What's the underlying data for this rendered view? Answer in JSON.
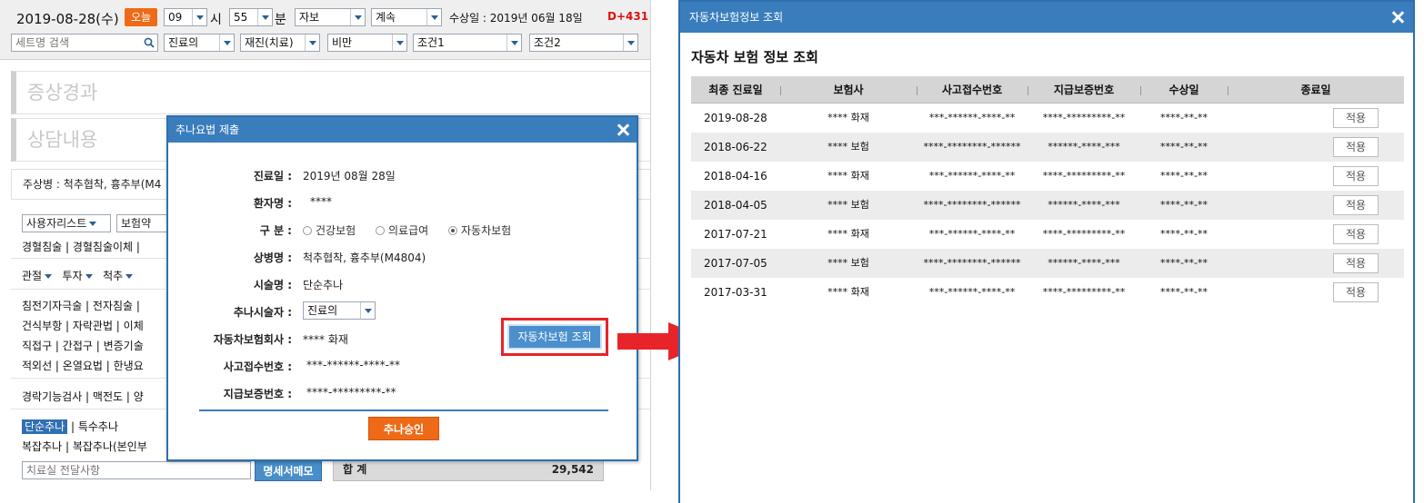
{
  "left_app": {
    "date": "2019-08-28(수)",
    "today_label": "오늘",
    "hour": "09",
    "hour_unit": "시",
    "minute": "55",
    "minute_unit": "분",
    "insurance_type": "자보",
    "continuation": "계속",
    "injury_date": "수상일 : 2019년 06월 18일",
    "d_plus": "D+431",
    "set_search_placeholder": "세트명 검색",
    "therapist_select": "진료의",
    "revisit_select": "재진(치료)",
    "obesity_select": "비만",
    "cond1": "조건1",
    "cond2": "조건2",
    "section_symptom": "증상경과",
    "section_consult": "상담내용",
    "diagnosis": "주상병 : 척추협착, 흉추부(M4",
    "user_list": "사용자리스트",
    "herbal": "보험약",
    "row_acupuncture": "경혈침술  |  경혈침술이체  |",
    "row_joint": [
      "관절",
      "투자",
      "척추"
    ],
    "row_elec1": "침전기자극술  |  전자침술  |",
    "row_elec2": "건식부항  |  자락관법  |  이체",
    "row_elec3": "직접구  |  간접구  |  변증기술",
    "row_elec4": "적외선  |  온열요법  |  한냉요",
    "row_pulse": "경락기능검사  |  맥전도  |  양",
    "simple_chuna": "단순추나",
    "special_chuna": "  |  특수추나",
    "row_complex": "복잡추나  |  복잡추나(본인부",
    "memo_placeholder": "치료실 전달사항",
    "memo_button": "명세서메모",
    "total_label": "합 계",
    "total_value": "29,542"
  },
  "chuna_modal": {
    "title": "추나요법 제출",
    "fields": {
      "visit_date_label": "진료일  :",
      "visit_date": "2019년 08월 28일",
      "patient_label": "환자명  :",
      "patient": "****",
      "category_label": "구  분  :",
      "category_options": [
        "건강보험",
        "의료급여",
        "자동차보험"
      ],
      "disease_label": "상병명  :",
      "disease": "척추협착, 흉추부(M4804)",
      "procedure_label": "시술명  :",
      "procedure": "단순추나",
      "practitioner_label": "추나시술자  :",
      "practitioner": "진료의",
      "ins_company_label": "자동차보험회사  :",
      "ins_company": "**** 화재",
      "accident_label": "사고접수번호  :",
      "accident_no": "***-******-****-**",
      "guarantee_label": "지급보증번호  :",
      "guarantee_no": "****-*********-**"
    },
    "lookup_button": "자동차보험 조회",
    "approve_button": "추나승인"
  },
  "ins_window": {
    "header": "자동차보험정보 조회",
    "title": "자동차 보험 정보 조회",
    "columns": [
      "최종 진료일",
      "보험사",
      "사고접수번호",
      "지급보증번호",
      "수상일",
      "종료일"
    ],
    "apply_label": "적용",
    "rows": [
      {
        "date": "2019-08-28",
        "company": "**** 화재",
        "accident": "***-******-****-**",
        "guarantee": "****-*********-**",
        "injury": "****-**-**"
      },
      {
        "date": "2018-06-22",
        "company": "**** 보험",
        "accident": "****-********-******",
        "guarantee": "******-****-***",
        "injury": "****-**-**"
      },
      {
        "date": "2018-04-16",
        "company": "**** 화재",
        "accident": "***-******-****-**",
        "guarantee": "****-*********-**",
        "injury": "****-**-**"
      },
      {
        "date": "2018-04-05",
        "company": "**** 보험",
        "accident": "****-********-******",
        "guarantee": "******-****-***",
        "injury": "****-**-**"
      },
      {
        "date": "2017-07-21",
        "company": "**** 화재",
        "accident": "***-******-****-**",
        "guarantee": "****-*********-**",
        "injury": "****-**-**"
      },
      {
        "date": "2017-07-05",
        "company": "**** 보험",
        "accident": "****-********-******",
        "guarantee": "******-****-***",
        "injury": "****-**-**"
      },
      {
        "date": "2017-03-31",
        "company": "**** 화재",
        "accident": "***-******-****-**",
        "guarantee": "****-*********-**",
        "injury": "****-**-**"
      }
    ]
  },
  "colors": {
    "header_blue": "#3a7dbd",
    "orange": "#ee6a16",
    "highlight_red": "#e8232a"
  }
}
